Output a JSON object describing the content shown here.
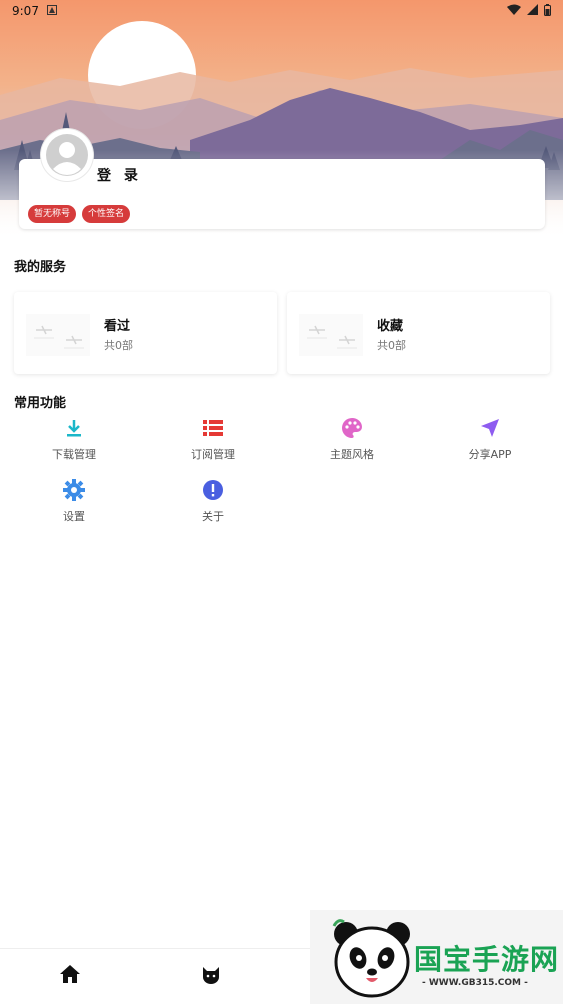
{
  "status_bar": {
    "time": "9:07"
  },
  "profile": {
    "login_label": "登 录",
    "tags": [
      "暂无称号",
      "个性签名"
    ]
  },
  "services": {
    "title": "我的服务",
    "items": [
      {
        "name": "看过",
        "count": "共0部"
      },
      {
        "name": "收藏",
        "count": "共0部"
      }
    ]
  },
  "functions": {
    "title": "常用功能",
    "items": [
      {
        "label": "下载管理",
        "icon": "download-icon",
        "color": "#1bb7c9"
      },
      {
        "label": "订阅管理",
        "icon": "list-icon",
        "color": "#e53935"
      },
      {
        "label": "主题风格",
        "icon": "palette-icon",
        "color": "#e066c8"
      },
      {
        "label": "分享APP",
        "icon": "send-icon",
        "color": "#8e5cf0"
      },
      {
        "label": "设置",
        "icon": "gear-icon",
        "color": "#3c8ce7"
      },
      {
        "label": "关于",
        "icon": "info-icon",
        "color": "#4a5fe0"
      }
    ]
  },
  "bottom_nav": [
    "home-icon",
    "cat-face-icon"
  ],
  "watermark": {
    "brand": "国宝手游网",
    "url": "- WWW.GB315.COM -"
  },
  "colors": {
    "tag": "#d63b3b",
    "sky_top": "#f4976c",
    "mountain": "#7d6b99"
  }
}
